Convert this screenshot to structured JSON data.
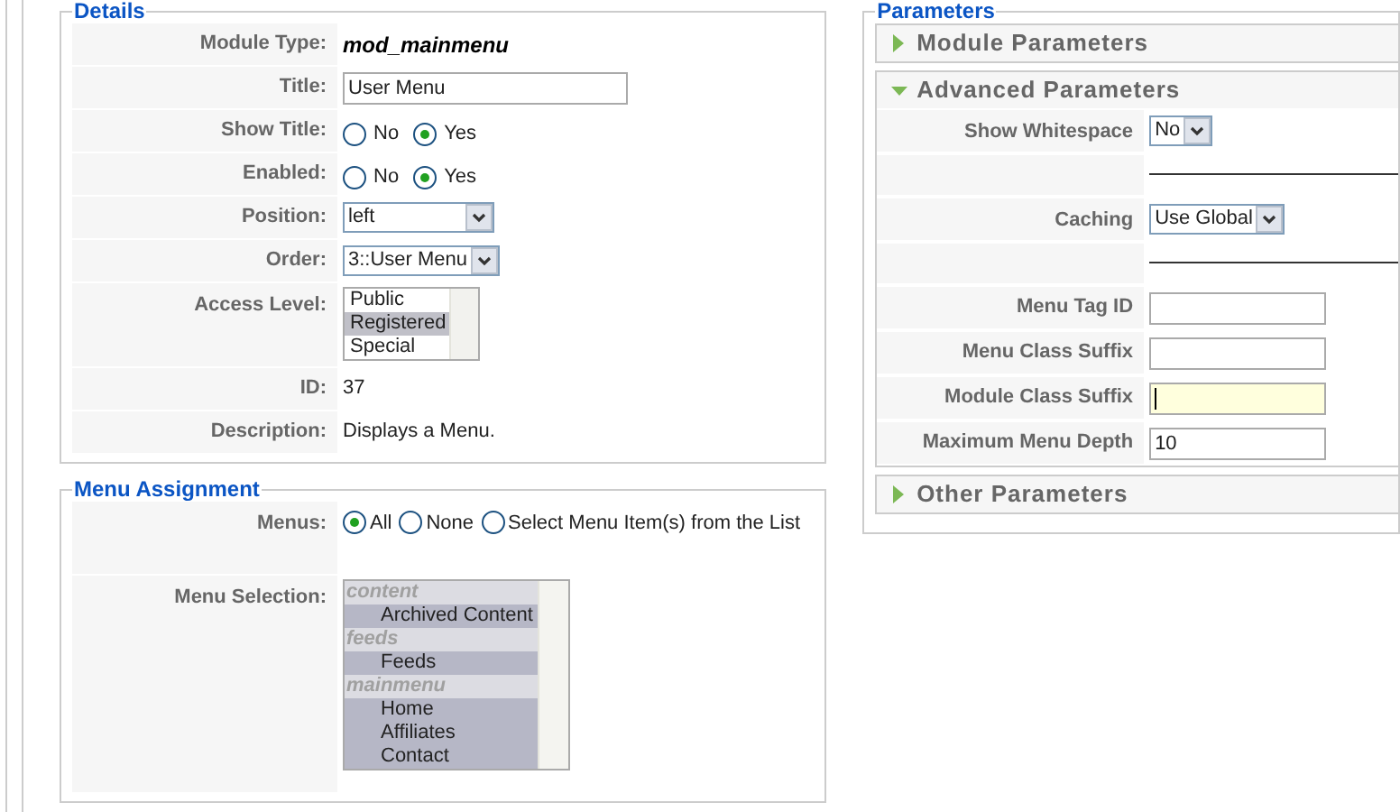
{
  "details": {
    "legend": "Details",
    "rows": [
      {
        "kind": "static",
        "label": "Module Type:",
        "value": "mod_mainmenu",
        "emphasis": true
      },
      {
        "kind": "text",
        "label": "Title:",
        "value": "User Menu"
      },
      {
        "kind": "radio",
        "label": "Show Title:",
        "options": [
          {
            "label": "No",
            "selected": false
          },
          {
            "label": "Yes",
            "selected": true
          }
        ]
      },
      {
        "kind": "radio",
        "label": "Enabled:",
        "options": [
          {
            "label": "No",
            "selected": false
          },
          {
            "label": "Yes",
            "selected": true
          }
        ]
      },
      {
        "kind": "select",
        "label": "Position:",
        "value": "left"
      },
      {
        "kind": "select",
        "label": "Order:",
        "value": "3::User Menu"
      },
      {
        "kind": "list",
        "label": "Access Level:",
        "options": [
          {
            "label": "Public",
            "selected": false
          },
          {
            "label": "Registered",
            "selected": true
          },
          {
            "label": "Special",
            "selected": false
          }
        ]
      },
      {
        "kind": "static",
        "label": "ID:",
        "value": "37",
        "emphasis": false
      },
      {
        "kind": "static",
        "label": "Description:",
        "value": "Displays a Menu.",
        "emphasis": false
      }
    ]
  },
  "menu_assignment": {
    "legend": "Menu Assignment",
    "menus": {
      "label": "Menus:",
      "options": [
        {
          "label": "All",
          "selected": true
        },
        {
          "label": "None",
          "selected": false
        },
        {
          "label": "Select Menu Item(s) from the List",
          "selected": false
        }
      ]
    },
    "menu_selection": {
      "label": "Menu Selection:",
      "groups": [
        {
          "label": "content",
          "items": [
            {
              "label": "Archived Content",
              "selected": true
            }
          ]
        },
        {
          "label": "feeds",
          "items": [
            {
              "label": "Feeds",
              "selected": true
            }
          ]
        },
        {
          "label": "mainmenu",
          "items": [
            {
              "label": "Home",
              "selected": true
            },
            {
              "label": "Affiliates",
              "selected": true
            },
            {
              "label": "Contact",
              "selected": true
            }
          ]
        }
      ]
    }
  },
  "parameters": {
    "legend": "Parameters",
    "panels": [
      {
        "title": "Module Parameters",
        "expanded": false
      },
      {
        "title": "Advanced Parameters",
        "expanded": true,
        "rows": [
          {
            "kind": "select",
            "label": "Show Whitespace",
            "value": "No"
          },
          {
            "kind": "spacer"
          },
          {
            "kind": "select",
            "label": "Caching",
            "value": "Use Global"
          },
          {
            "kind": "spacer"
          },
          {
            "kind": "text",
            "label": "Menu Tag ID",
            "value": "",
            "focused": false
          },
          {
            "kind": "text",
            "label": "Menu Class Suffix",
            "value": "",
            "focused": false
          },
          {
            "kind": "text",
            "label": "Module Class Suffix",
            "value": "",
            "focused": true
          },
          {
            "kind": "text",
            "label": "Maximum Menu Depth",
            "value": "10",
            "focused": false
          }
        ]
      },
      {
        "title": "Other Parameters",
        "expanded": false
      }
    ]
  }
}
